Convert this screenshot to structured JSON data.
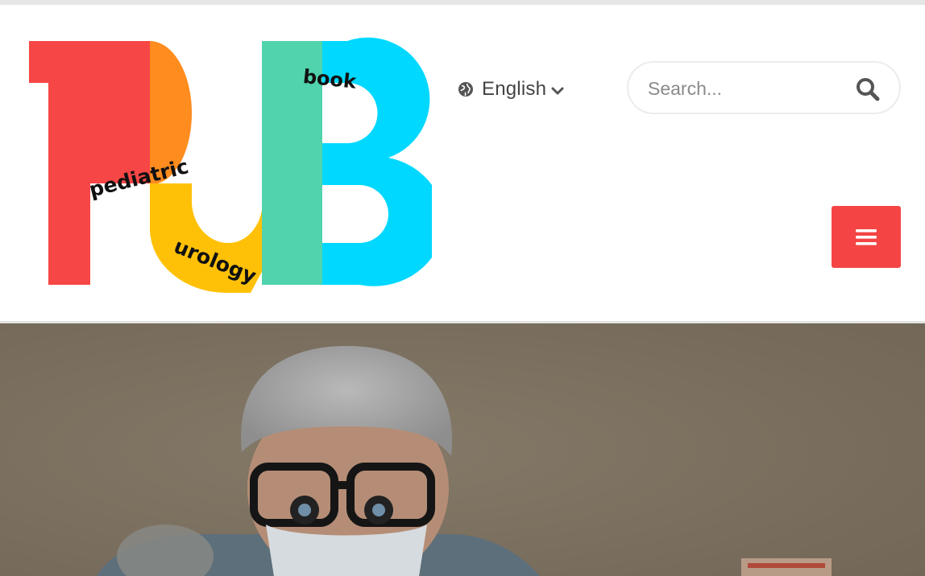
{
  "site": {
    "brand_letters": [
      "P",
      "U",
      "B"
    ],
    "logo_words": {
      "top": "book",
      "left": "pediatric",
      "bottom": "urology"
    },
    "brand_colors": {
      "red": "#f74646",
      "orange": "#ff8c1f",
      "yellow": "#ffc107",
      "green": "#51d3ad",
      "cyan": "#00d8ff"
    }
  },
  "header": {
    "language": {
      "label": "English",
      "icon": "globe-icon",
      "chevron": "chevron-down-icon"
    },
    "search": {
      "placeholder": "Search...",
      "value": "",
      "icon": "search-icon"
    },
    "menu": {
      "icon": "hamburger-menu-icon",
      "color": "#f44444"
    }
  },
  "hero": {
    "image": "surgeon-portrait-photo",
    "overlay_color": "#786c5d"
  }
}
